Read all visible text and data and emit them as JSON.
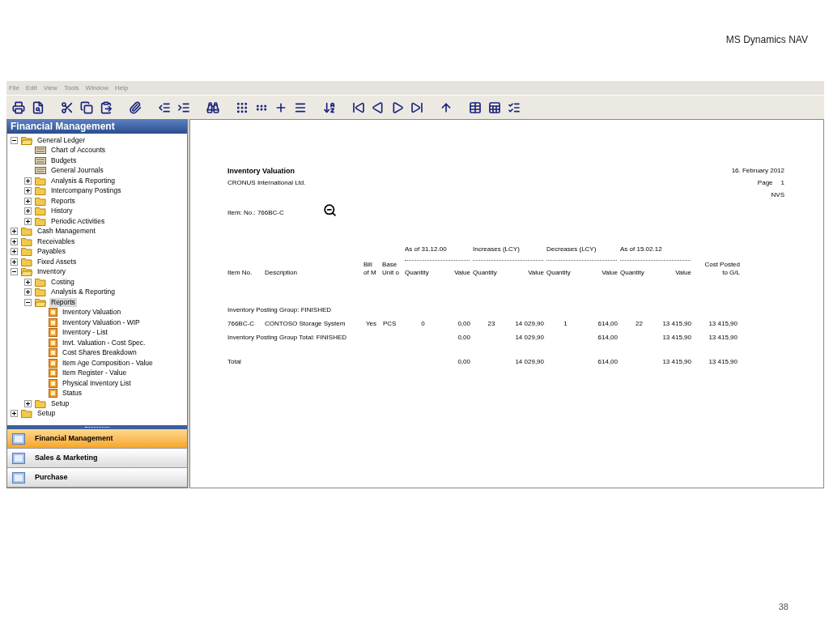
{
  "slide": {
    "title": "MS Dynamics NAV",
    "page_number": "38"
  },
  "menu": [
    "File",
    "Edit",
    "View",
    "Tools",
    "Window",
    "Help"
  ],
  "navigation": {
    "title": "Financial Management",
    "tree": [
      {
        "label": "General Ledger",
        "kind": "folder",
        "expanded": true,
        "selected": false,
        "children": [
          {
            "label": "Chart of Accounts",
            "kind": "form",
            "selected": false
          },
          {
            "label": "Budgets",
            "kind": "form",
            "selected": false
          },
          {
            "label": "General Journals",
            "kind": "form",
            "selected": false
          },
          {
            "label": "Analysis & Reporting",
            "kind": "folder",
            "expanded": false,
            "selected": false
          },
          {
            "label": "Intercompany Postings",
            "kind": "folder",
            "expanded": false,
            "selected": false
          },
          {
            "label": "Reports",
            "kind": "folder",
            "expanded": false,
            "selected": false
          },
          {
            "label": "History",
            "kind": "folder",
            "expanded": false,
            "selected": false
          },
          {
            "label": "Periodic Activities",
            "kind": "folder",
            "expanded": false,
            "selected": false
          }
        ]
      },
      {
        "label": "Cash Management",
        "kind": "folder",
        "expanded": false,
        "selected": false
      },
      {
        "label": "Receivables",
        "kind": "folder",
        "expanded": false,
        "selected": false
      },
      {
        "label": "Payables",
        "kind": "folder",
        "expanded": false,
        "selected": false
      },
      {
        "label": "Fixed Assets",
        "kind": "folder",
        "expanded": false,
        "selected": false
      },
      {
        "label": "Inventory",
        "kind": "folder",
        "expanded": true,
        "selected": false,
        "children": [
          {
            "label": "Costing",
            "kind": "folder",
            "expanded": false,
            "selected": false
          },
          {
            "label": "Analysis & Reporting",
            "kind": "folder",
            "expanded": false,
            "selected": false
          },
          {
            "label": "Reports",
            "kind": "folder",
            "expanded": true,
            "selected": true,
            "children": [
              {
                "label": "Inventory Valuation",
                "kind": "report",
                "selected": false
              },
              {
                "label": "Inventory Valuation - WIP",
                "kind": "report",
                "selected": false
              },
              {
                "label": "Inventory - List",
                "kind": "report",
                "selected": false
              },
              {
                "label": "Invt. Valuation - Cost Spec.",
                "kind": "report",
                "selected": false
              },
              {
                "label": "Cost Shares Breakdown",
                "kind": "report",
                "selected": false
              },
              {
                "label": "Item Age Composition - Value",
                "kind": "report",
                "selected": false
              },
              {
                "label": "Item Register - Value",
                "kind": "report",
                "selected": false
              },
              {
                "label": "Physical Inventory List",
                "kind": "report",
                "selected": false
              },
              {
                "label": "Status",
                "kind": "report",
                "selected": false
              }
            ]
          },
          {
            "label": "Setup",
            "kind": "folder",
            "expanded": false,
            "selected": false
          }
        ]
      },
      {
        "label": "Setup",
        "kind": "folder",
        "expanded": false,
        "selected": false
      }
    ],
    "buttons": [
      {
        "label": "Financial Management",
        "selected": true
      },
      {
        "label": "Sales & Marketing",
        "selected": false
      },
      {
        "label": "Purchase",
        "selected": false
      }
    ]
  },
  "report": {
    "title": "Inventory Valuation",
    "company": "CRONUS International Ltd.",
    "date": "16. February 2012",
    "page_label": "Page",
    "page_number": "1",
    "user": "NVS",
    "filter": "Item: No.: 766BC-C",
    "column_groups": [
      "As of 31.12.00",
      "Increases (LCY)",
      "Decreases (LCY)",
      "As of 15.02.12"
    ],
    "columns": {
      "item_no": "Item No.",
      "description": "Description",
      "bill_of_materials": "Bill of M",
      "base_unit": "Base Unit o",
      "pairs": [
        [
          "Quantity",
          "Value"
        ],
        [
          "Quantity",
          "Value"
        ],
        [
          "Quantity",
          "Value"
        ],
        [
          "Quantity",
          "Value"
        ]
      ],
      "cost_posted": "Cost Posted to G/L"
    },
    "rows": [
      {
        "kind": "group",
        "label": "Inventory Posting Group: FINISHED"
      },
      {
        "kind": "item",
        "item_no": "766BC-C",
        "description": "CONTOSO Storage System",
        "bill_of_materials": "Yes",
        "base_unit": "PCS",
        "values": [
          "0",
          "0,00",
          "23",
          "14 029,90",
          "1",
          "614,00",
          "22",
          "13 415,90",
          "13 415,90"
        ]
      },
      {
        "kind": "subtotal",
        "label": "Inventory Posting Group Total: FINISHED",
        "values": [
          "0,00",
          "14 029,90",
          "614,00",
          "13 415,90",
          "13 415,90"
        ]
      },
      {
        "kind": "total",
        "label": "Total",
        "values": [
          "0,00",
          "14 029,90",
          "614,00",
          "13 415,90",
          "13 415,90"
        ]
      }
    ]
  }
}
